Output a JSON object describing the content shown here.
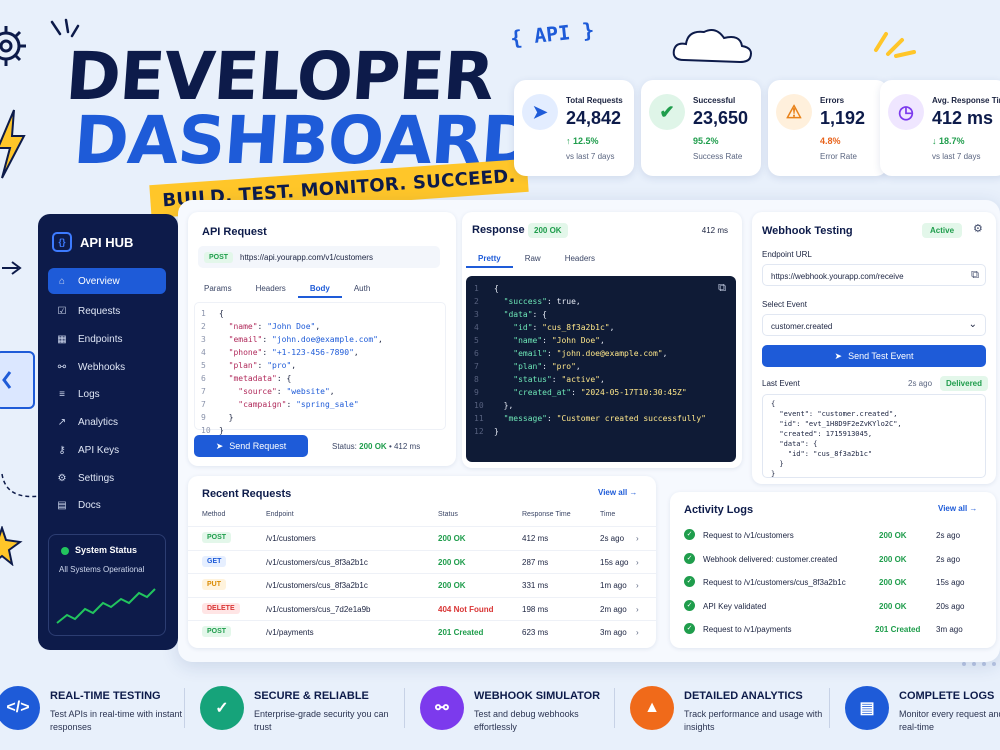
{
  "hero": {
    "line1": "DEVELOPER",
    "line2": "DASHBOARD",
    "tagline": "BUILD. TEST. MONITOR. SUCCEED.",
    "api_badge": "{ API }"
  },
  "stats": [
    {
      "label": "Total Requests",
      "value": "24,842",
      "change": "↑ 12.5%",
      "sub": "vs last 7 days",
      "color": "#1e5bd8"
    },
    {
      "label": "Successful",
      "value": "23,650",
      "change": "95.2%",
      "sub": "Success Rate",
      "color": "#1f9d4c"
    },
    {
      "label": "Errors",
      "value": "1,192",
      "change": "4.8%",
      "sub": "Error Rate",
      "color": "#e8821a"
    },
    {
      "label": "Avg. Response Time",
      "value": "412 ms",
      "change": "↓ 18.7%",
      "sub": "vs last 7 days",
      "color": "#7c3aed"
    }
  ],
  "sidebar": {
    "brand": "API HUB",
    "logo": "{}",
    "items": [
      {
        "label": "Overview",
        "icon": "home-icon",
        "glyph": "⌂"
      },
      {
        "label": "Requests",
        "icon": "check-icon",
        "glyph": "☑"
      },
      {
        "label": "Endpoints",
        "icon": "grid-icon",
        "glyph": "▦"
      },
      {
        "label": "Webhooks",
        "icon": "webhook-icon",
        "glyph": "⚯"
      },
      {
        "label": "Logs",
        "icon": "list-icon",
        "glyph": "≡"
      },
      {
        "label": "Analytics",
        "icon": "chart-icon",
        "glyph": "↗"
      },
      {
        "label": "API Keys",
        "icon": "key-icon",
        "glyph": "⚷"
      },
      {
        "label": "Settings",
        "icon": "gear-icon",
        "glyph": "⚙"
      },
      {
        "label": "Docs",
        "icon": "doc-icon",
        "glyph": "▤"
      }
    ],
    "system_status": "System Status",
    "system_sub": "All Systems Operational"
  },
  "request": {
    "title": "API Request",
    "method": "POST",
    "url": "https://api.yourapp.com/v1/customers",
    "tabs": [
      "Params",
      "Headers",
      "Body",
      "Auth"
    ],
    "send": "Send Request",
    "status_label": "Status:",
    "status": "200 OK",
    "time": "• 412 ms",
    "code_lines": [
      [
        "1",
        "{"
      ],
      [
        "2",
        "  \"name\": \"John Doe\","
      ],
      [
        "3",
        "  \"email\": \"john.doe@example.com\","
      ],
      [
        "4",
        "  \"phone\": \"+1-123-456-7890\","
      ],
      [
        "5",
        "  \"plan\": \"pro\","
      ],
      [
        "6",
        "  \"metadata\": {"
      ],
      [
        "7",
        "    \"source\": \"website\","
      ],
      [
        "7",
        "    \"campaign\": \"spring_sale\""
      ],
      [
        "9",
        "  }"
      ],
      [
        "10",
        "}"
      ]
    ]
  },
  "response": {
    "title": "Response",
    "status": "200 OK",
    "time": "412 ms",
    "tabs": [
      "Pretty",
      "Raw",
      "Headers"
    ],
    "code_lines": [
      [
        "1",
        "{"
      ],
      [
        "2",
        "  \"success\": true,"
      ],
      [
        "3",
        "  \"data\": {"
      ],
      [
        "4",
        "    \"id\": \"cus_8f3a2b1c\","
      ],
      [
        "5",
        "    \"name\": \"John Doe\","
      ],
      [
        "6",
        "    \"email\": \"john.doe@example.com\","
      ],
      [
        "7",
        "    \"plan\": \"pro\","
      ],
      [
        "8",
        "    \"status\": \"active\","
      ],
      [
        "9",
        "    \"created_at\": \"2024-05-17T10:30:45Z\""
      ],
      [
        "10",
        "  },"
      ],
      [
        "11",
        "  \"message\": \"Customer created successfully\""
      ],
      [
        "12",
        "}"
      ]
    ]
  },
  "webhook": {
    "title": "Webhook Testing",
    "badge": "Active",
    "endpoint_label": "Endpoint URL",
    "endpoint": "https://webhook.yourapp.com/receive",
    "event_label": "Select Event",
    "event": "customer.created",
    "send": "Send Test Event",
    "last_event": "Last Event",
    "last_time": "2s ago",
    "last_status": "Delivered",
    "code_lines": [
      "{",
      "  \"event\": \"customer.created\",",
      "  \"id\": \"evt_1H8D9F2eZvKYlo2C\",",
      "  \"created\": 1715913045,",
      "  \"data\": {",
      "    \"id\": \"cus_8f3a2b1c\"",
      "  }",
      "}"
    ]
  },
  "recent": {
    "title": "Recent Requests",
    "view_all": "View all →",
    "headers": [
      "Method",
      "Endpoint",
      "Status",
      "Response Time",
      "Time"
    ],
    "rows": [
      {
        "method": "POST",
        "endpoint": "/v1/customers",
        "status": "200 OK",
        "rt": "412 ms",
        "time": "2s ago"
      },
      {
        "method": "GET",
        "endpoint": "/v1/customers/cus_8f3a2b1c",
        "status": "200 OK",
        "rt": "287 ms",
        "time": "15s ago"
      },
      {
        "method": "PUT",
        "endpoint": "/v1/customers/cus_8f3a2b1c",
        "status": "200 OK",
        "rt": "331 ms",
        "time": "1m ago"
      },
      {
        "method": "DELETE",
        "endpoint": "/v1/customers/cus_7d2e1a9b",
        "status": "404 Not Found",
        "rt": "198 ms",
        "time": "2m ago"
      },
      {
        "method": "POST",
        "endpoint": "/v1/payments",
        "status": "201 Created",
        "rt": "623 ms",
        "time": "3m ago"
      }
    ]
  },
  "activity": {
    "title": "Activity Logs",
    "view_all": "View all →",
    "rows": [
      {
        "text": "Request to /v1/customers",
        "status": "200 OK",
        "time": "2s ago"
      },
      {
        "text": "Webhook delivered: customer.created",
        "status": "200 OK",
        "time": "2s ago"
      },
      {
        "text": "Request to /v1/customers/cus_8f3a2b1c",
        "status": "200 OK",
        "time": "15s ago"
      },
      {
        "text": "API Key validated",
        "status": "200 OK",
        "time": "20s ago"
      },
      {
        "text": "Request to /v1/payments",
        "status": "201 Created",
        "time": "3m ago"
      }
    ]
  },
  "features": [
    {
      "title": "REAL-TIME TESTING",
      "desc": "Test APIs in real-time with instant responses",
      "color": "#1e5bd8",
      "icon": "code-icon",
      "glyph": "</>"
    },
    {
      "title": "SECURE & RELIABLE",
      "desc": "Enterprise-grade security you can trust",
      "color": "#16a37a",
      "icon": "shield-icon",
      "glyph": "✓"
    },
    {
      "title": "WEBHOOK SIMULATOR",
      "desc": "Test and debug webhooks effortlessly",
      "color": "#7c3aed",
      "icon": "webhook-icon",
      "glyph": "⚯"
    },
    {
      "title": "DETAILED ANALYTICS",
      "desc": "Track performance and usage with insights",
      "color": "#f06a1a",
      "icon": "analytics-icon",
      "glyph": "▲"
    },
    {
      "title": "COMPLETE LOGS",
      "desc": "Monitor every request and event in real-time",
      "color": "#1e5bd8",
      "icon": "logs-icon",
      "glyph": "▤"
    }
  ]
}
